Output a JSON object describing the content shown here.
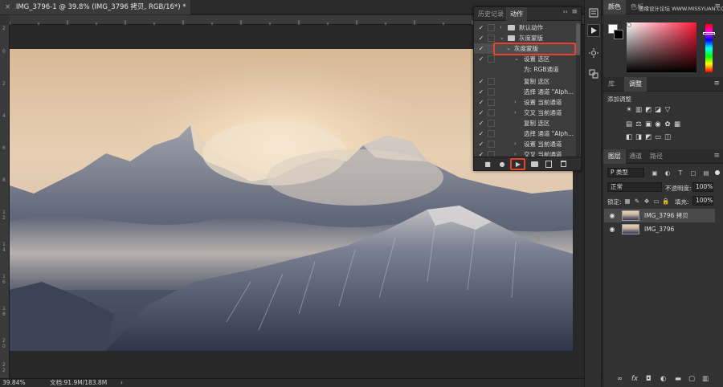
{
  "document": {
    "tab_title": "IMG_3796-1 @ 39.8% (IMG_3796 拷贝, RGB/16*) *",
    "close_glyph": "×"
  },
  "ruler": {
    "top_ticks": [
      "",
      "",
      "",
      "",
      "",
      "",
      "",
      "",
      "",
      "",
      ""
    ],
    "left_ticks": [
      "2",
      "0",
      "2",
      "4",
      "6",
      "8",
      "1",
      "2",
      "1",
      "4",
      "1",
      "6",
      "1",
      "8",
      "2",
      "0",
      "2",
      "2",
      "2",
      "4",
      "2",
      "6"
    ]
  },
  "status": {
    "zoom": "39.84%",
    "doc_info": "文档:91.9M/183.8M",
    "arrow": "›"
  },
  "actions_panel": {
    "tab_history": "历史记录",
    "tab_actions": "动作",
    "expand": "››",
    "menu": "≡",
    "rows": [
      {
        "check": "✓",
        "dialog": true,
        "arrow": "›",
        "icon": "folder",
        "label": "默认动作",
        "indent": 0
      },
      {
        "check": "✓",
        "dialog": false,
        "arrow": "⌄",
        "icon": "folder",
        "label": "灰度蒙版",
        "indent": 1
      },
      {
        "check": "✓",
        "dialog": false,
        "arrow": "⌄",
        "icon": "",
        "label": "灰度蒙版",
        "indent": 2,
        "selected": true
      },
      {
        "check": "✓",
        "dialog": false,
        "arrow": "⌄",
        "icon": "",
        "label": "设置 选区",
        "indent": 3
      },
      {
        "check": "",
        "dialog": false,
        "arrow": "",
        "icon": "",
        "label": "为: RGB通道",
        "indent": 4
      },
      {
        "check": "✓",
        "dialog": false,
        "arrow": "",
        "icon": "",
        "label": "复制 选区",
        "indent": 3
      },
      {
        "check": "✓",
        "dialog": false,
        "arrow": "",
        "icon": "",
        "label": "选择 通道 \"Alph...",
        "indent": 3
      },
      {
        "check": "✓",
        "dialog": false,
        "arrow": "›",
        "icon": "",
        "label": "设置 当前通道",
        "indent": 3
      },
      {
        "check": "✓",
        "dialog": false,
        "arrow": "›",
        "icon": "",
        "label": "交叉 当前通道",
        "indent": 3
      },
      {
        "check": "✓",
        "dialog": false,
        "arrow": "",
        "icon": "",
        "label": "复制 选区",
        "indent": 3
      },
      {
        "check": "✓",
        "dialog": false,
        "arrow": "",
        "icon": "",
        "label": "选择 通道 \"Alph...",
        "indent": 3
      },
      {
        "check": "✓",
        "dialog": false,
        "arrow": "›",
        "icon": "",
        "label": "设置 当前通道",
        "indent": 3
      },
      {
        "check": "✓",
        "dialog": false,
        "arrow": "›",
        "icon": "",
        "label": "交叉 当前通道",
        "indent": 3
      }
    ],
    "footer": {
      "stop": "■",
      "record": "●",
      "play": "▶",
      "new_set": "folder",
      "new_action": "new",
      "delete": "trash"
    }
  },
  "right_panels": {
    "color_tab": "颜色",
    "color_tab2": "色板",
    "watermark": "思缘设计论坛 WWW.MISSYUAN.COM",
    "fg_color": "#ffffff",
    "bg_color": "#000000",
    "hue_color": "#ff1a3a",
    "lib_tab": "库",
    "adjust_tab": "调整",
    "adjust_label": "添加调整",
    "layers_tab": "图层",
    "channels_tab": "通道",
    "paths_tab": "路径",
    "kind_filter": "P 类型",
    "blend_mode": "正常",
    "opacity_label": "不透明度:",
    "opacity_value": "100%",
    "lock_label": "锁定:",
    "fill_label": "填充:",
    "fill_value": "100%",
    "layers": [
      {
        "name": "IMG_3796 拷贝",
        "selected": true
      },
      {
        "name": "IMG_3796",
        "selected": false
      }
    ],
    "menu": "≡"
  },
  "accent": {
    "highlight": "#e8432a"
  }
}
